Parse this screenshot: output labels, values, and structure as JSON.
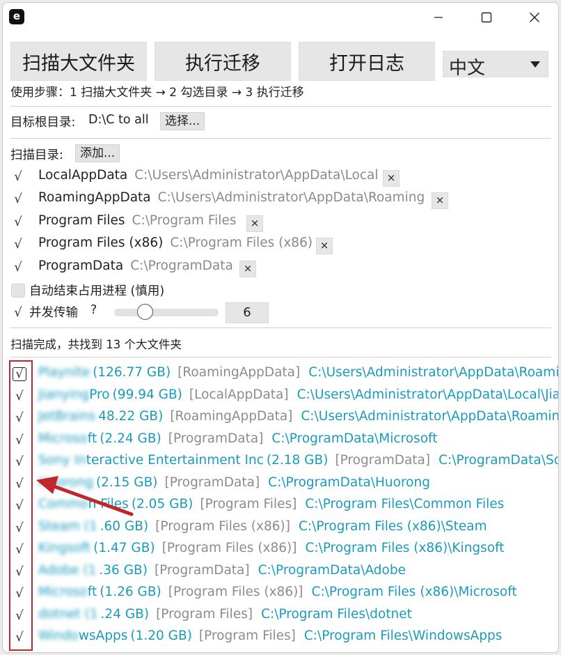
{
  "window": {
    "app_icon_letter": "e"
  },
  "toolbar": {
    "scan_label": "扫描大文件夹",
    "migrate_label": "执行迁移",
    "log_label": "打开日志",
    "language": "中文"
  },
  "steps_hint": "使用步骤：1 扫描大文件夹 → 2 勾选目录 → 3 执行迁移",
  "target": {
    "label": "目标根目录:",
    "value": "D:\\C to all",
    "choose_label": "选择..."
  },
  "scan_dirs": {
    "label": "扫描目录:",
    "add_label": "添加...",
    "items": [
      {
        "name": "LocalAppData",
        "path": "C:\\Users\\Administrator\\AppData\\Local",
        "checked": true
      },
      {
        "name": "RoamingAppData",
        "path": "C:\\Users\\Administrator\\AppData\\Roaming",
        "checked": true
      },
      {
        "name": "Program Files",
        "path": "C:\\Program Files",
        "checked": true
      },
      {
        "name": "Program Files (x86)",
        "path": "C:\\Program Files (x86)",
        "checked": true
      },
      {
        "name": "ProgramData",
        "path": "C:\\ProgramData",
        "checked": true
      }
    ],
    "remove_glyph": "×"
  },
  "options": {
    "auto_kill_label": "自动结束占用进程 (慎用)",
    "auto_kill_checked": false,
    "concurrency_label": "并发传输",
    "concurrency_help": "?",
    "concurrency_checked": true,
    "concurrency_value": "6",
    "concurrency_slider_fraction": 0.3
  },
  "status": "扫描完成，共找到 13 个大文件夹",
  "results": [
    {
      "blurred": "Playnite",
      "name_visible": "",
      "size": "(126.77 GB)",
      "source": "[RoamingAppData]",
      "path": "C:\\Users\\Administrator\\AppData\\Roaming",
      "checked": true
    },
    {
      "blurred": "Jianying",
      "name_visible": "Pro",
      "size": "(99.94 GB)",
      "source": "[LocalAppData]",
      "path": "C:\\Users\\Administrator\\AppData\\Local\\Jia",
      "checked": true
    },
    {
      "blurred": "JetBrains",
      "name_visible": "",
      "size": "48.22 GB)",
      "source": "[RoamingAppData]",
      "path": "C:\\Users\\Administrator\\AppData\\Roaming\\",
      "checked": true
    },
    {
      "blurred": "Microso",
      "name_visible": "ft",
      "size": "(2.24 GB)",
      "source": "[ProgramData]",
      "path": "C:\\ProgramData\\Microsoft",
      "checked": true
    },
    {
      "blurred": "Sony In",
      "name_visible": "teractive Entertainment Inc",
      "size": "(2.18 GB)",
      "source": "[ProgramData]",
      "path": "C:\\ProgramData\\Sony",
      "checked": true
    },
    {
      "blurred": "Huorong",
      "name_visible": "",
      "size": "(2.15 GB)",
      "source": "[ProgramData]",
      "path": "C:\\ProgramData\\Huorong",
      "checked": true
    },
    {
      "blurred": "Commo",
      "name_visible": "n Files",
      "size": "(2.05 GB)",
      "source": "[Program Files]",
      "path": "C:\\Program Files\\Common Files",
      "checked": true
    },
    {
      "blurred": "Steam (1",
      "name_visible": "",
      "size": ".60 GB)",
      "source": "[Program Files (x86)]",
      "path": "C:\\Program Files (x86)\\Steam",
      "checked": true
    },
    {
      "blurred": "Kingsoft",
      "name_visible": "",
      "size": "(1.47 GB)",
      "source": "[Program Files (x86)]",
      "path": "C:\\Program Files (x86)\\Kingsoft",
      "checked": true
    },
    {
      "blurred": "Adobe (1",
      "name_visible": "",
      "size": ".36 GB)",
      "source": "[ProgramData]",
      "path": "C:\\ProgramData\\Adobe",
      "checked": true
    },
    {
      "blurred": "Microso",
      "name_visible": "ft",
      "size": "(1.26 GB)",
      "source": "[Program Files (x86)]",
      "path": "C:\\Program Files (x86)\\Microsoft",
      "checked": true
    },
    {
      "blurred": "dotnet (1",
      "name_visible": "",
      "size": ".24 GB)",
      "source": "[Program Files]",
      "path": "C:\\Program Files\\dotnet",
      "checked": true
    },
    {
      "blurred": "Windo",
      "name_visible": "wsApps",
      "size": "(1.20 GB)",
      "source": "[Program Files]",
      "path": "C:\\Program Files\\WindowsApps",
      "checked": true
    }
  ],
  "check_glyph": "√",
  "colors": {
    "link": "#1a9bbd",
    "source": "#8c8c8c",
    "annotation": "#c0262b"
  }
}
